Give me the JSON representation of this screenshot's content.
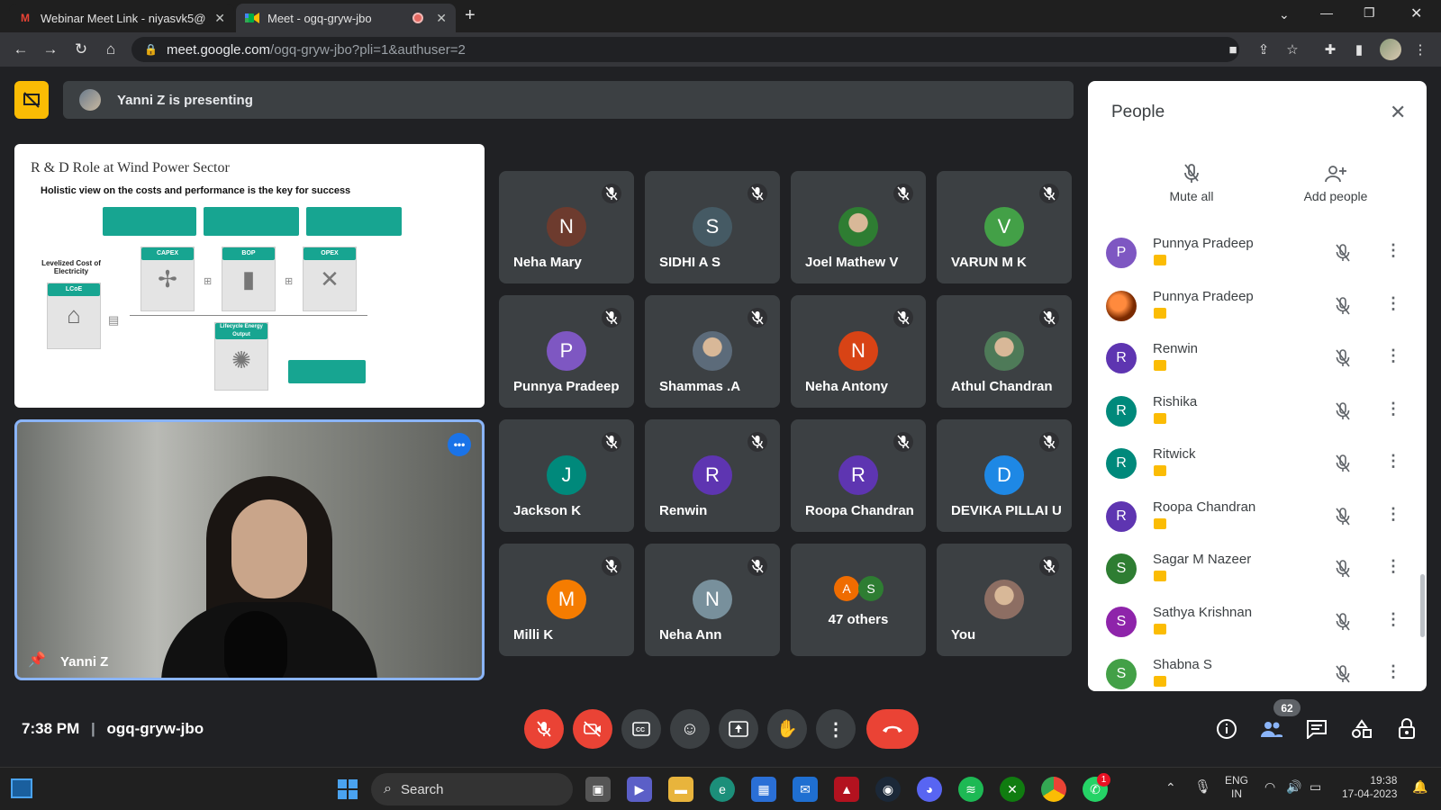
{
  "browser": {
    "tabs": [
      {
        "title": "Webinar Meet Link - niyasvk5@",
        "icon": "gmail-icon"
      },
      {
        "title": "Meet - ogq-gryw-jbo",
        "icon": "meet-icon",
        "recording": true
      }
    ],
    "url_host": "meet.google.com",
    "url_path": "/ogq-gryw-jbo?pli=1&authuser=2"
  },
  "banner": {
    "text": "Yanni Z is presenting"
  },
  "slide": {
    "title": "R & D Role at Wind Power Sector",
    "subtitle": "Holistic view on the costs and performance is the key for success",
    "lcoe_label": "Levelized Cost of Electricity",
    "lcoe_box": "LCoE",
    "capex": "CAPEX",
    "bop": "BOP",
    "opex": "OPEX",
    "lifecycle": "Lifecycle Energy Output"
  },
  "presenter": {
    "name": "Yanni Z"
  },
  "tiles": [
    {
      "name": "Neha Mary",
      "initial": "N",
      "color": "#6d3b2e",
      "muted": true
    },
    {
      "name": "SIDHI A S",
      "initial": "S",
      "color": "#455a64",
      "muted": true
    },
    {
      "name": "Joel Mathew V",
      "initial": "",
      "color": "#2e7d32",
      "muted": true,
      "photo": true
    },
    {
      "name": "VARUN M K",
      "initial": "V",
      "color": "#43a047",
      "muted": true
    },
    {
      "name": "Punnya Pradeep",
      "initial": "P",
      "color": "#7e57c2",
      "muted": true
    },
    {
      "name": "Shammas .A",
      "initial": "",
      "color": "#5c6b7a",
      "muted": true,
      "photo": true
    },
    {
      "name": "Neha Antony",
      "initial": "N",
      "color": "#d84315",
      "muted": true
    },
    {
      "name": "Athul Chandran",
      "initial": "",
      "color": "#4e7a58",
      "muted": true,
      "photo": true
    },
    {
      "name": "Jackson K",
      "initial": "J",
      "color": "#00897b",
      "muted": true
    },
    {
      "name": "Renwin",
      "initial": "R",
      "color": "#5e35b1",
      "muted": true
    },
    {
      "name": "Roopa Chandran",
      "initial": "R",
      "color": "#5e35b1",
      "muted": true
    },
    {
      "name": "DEVIKA PILLAI U",
      "initial": "D",
      "color": "#1e88e5",
      "muted": true
    },
    {
      "name": "Milli K",
      "initial": "M",
      "color": "#f57c00",
      "muted": true
    },
    {
      "name": "Neha Ann",
      "initial": "N",
      "color": "#78909c",
      "muted": true
    },
    {
      "name": "47 others",
      "others": true,
      "muted": false
    },
    {
      "name": "You",
      "initial": "",
      "color": "#8d6e63",
      "muted": true,
      "photo": true
    }
  ],
  "others_avatars": [
    {
      "initial": "A",
      "color": "#ef6c00"
    },
    {
      "initial": "S",
      "color": "#2e7d32"
    }
  ],
  "bottom": {
    "time": "7:38 PM",
    "meeting_code": "ogq-gryw-jbo",
    "people_count": "62"
  },
  "panel": {
    "title": "People",
    "mute_all": "Mute all",
    "add_people": "Add people",
    "participants": [
      {
        "name": "Punnya Pradeep",
        "initial": "P",
        "color": "#7e57c2"
      },
      {
        "name": "Punnya Pradeep",
        "initial": "",
        "color": "#e65100",
        "photo": true
      },
      {
        "name": "Renwin",
        "initial": "R",
        "color": "#5e35b1"
      },
      {
        "name": "Rishika",
        "initial": "R",
        "color": "#00897b"
      },
      {
        "name": "Ritwick",
        "initial": "R",
        "color": "#00897b"
      },
      {
        "name": "Roopa Chandran",
        "initial": "R",
        "color": "#5e35b1"
      },
      {
        "name": "Sagar M Nazeer",
        "initial": "S",
        "color": "#2e7d32"
      },
      {
        "name": "Sathya Krishnan",
        "initial": "S",
        "color": "#8e24aa"
      },
      {
        "name": "Shabna S",
        "initial": "S",
        "color": "#43a047"
      }
    ]
  },
  "taskbar": {
    "search": "Search",
    "lang_top": "ENG",
    "lang_bottom": "IN",
    "clock_time": "19:38",
    "clock_date": "17-04-2023",
    "whatsapp_badge": "1"
  }
}
